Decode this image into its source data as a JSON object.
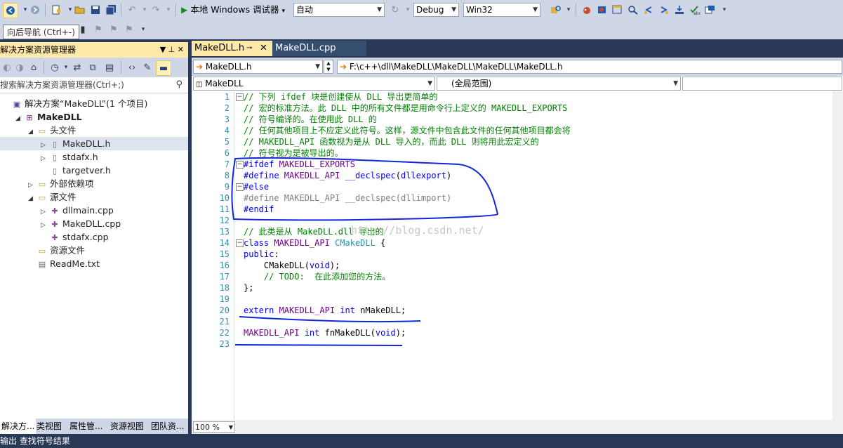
{
  "toolbar": {
    "start_label": "本地 Windows 调试器",
    "start_arrow": "▾",
    "auto_combo": "自动",
    "config_combo": "Debug",
    "platform_combo": "Win32"
  },
  "tooltip": "向后导航 (Ctrl+-)",
  "solution_explorer": {
    "title": "解决方案资源管理器",
    "title_pin": "▼ ⊥ ✕",
    "search_placeholder": "搜索解决方案资源管理器(Ctrl+;)",
    "tree": [
      {
        "label": "解决方案“MakeDLL”(1 个项目)",
        "icon": "solution-icon",
        "indent": 0,
        "tri": ""
      },
      {
        "label": "MakeDLL",
        "icon": "project-icon",
        "indent": 1,
        "tri": "◢",
        "bold": true
      },
      {
        "label": "头文件",
        "icon": "folder-icon",
        "indent": 2,
        "tri": "◢"
      },
      {
        "label": "MakeDLL.h",
        "icon": "header-file-icon",
        "indent": 3,
        "tri": "▷",
        "selected": true
      },
      {
        "label": "stdafx.h",
        "icon": "header-file-icon",
        "indent": 3,
        "tri": "▷"
      },
      {
        "label": "targetver.h",
        "icon": "header-file-icon",
        "indent": 3,
        "tri": ""
      },
      {
        "label": "外部依赖项",
        "icon": "folder-icon",
        "indent": 2,
        "tri": "▷"
      },
      {
        "label": "源文件",
        "icon": "folder-icon",
        "indent": 2,
        "tri": "◢"
      },
      {
        "label": "dllmain.cpp",
        "icon": "cpp-file-icon",
        "indent": 3,
        "tri": "▷"
      },
      {
        "label": "MakeDLL.cpp",
        "icon": "cpp-file-icon",
        "indent": 3,
        "tri": "▷"
      },
      {
        "label": "stdafx.cpp",
        "icon": "cpp-file-icon",
        "indent": 3,
        "tri": ""
      },
      {
        "label": "资源文件",
        "icon": "folder-icon",
        "indent": 2,
        "tri": ""
      },
      {
        "label": "ReadMe.txt",
        "icon": "text-file-icon",
        "indent": 2,
        "tri": ""
      }
    ],
    "bottom_tabs": [
      "解决方...",
      "类视图",
      "属性管...",
      "资源视图",
      "团队资..."
    ]
  },
  "status": "输出   查找符号结果",
  "editor": {
    "tabs": [
      {
        "label": "MakeDLL.h",
        "active": true
      },
      {
        "label": "MakeDLL.cpp",
        "active": false
      }
    ],
    "nav_file": "MakeDLL.h",
    "nav_path": "F:\\c++\\dll\\MakeDLL\\MakeDLL\\MakeDLL\\MakeDLL.h",
    "scope_project": "MakeDLL",
    "scope_global": "(全局范围)",
    "zoom": "100 %",
    "watermark": "http://blog.csdn.net/"
  },
  "code_lines": [
    [
      [
        "c-com",
        "// 下列 ifdef 块是创建使从 DLL 导出更简单的"
      ]
    ],
    [
      [
        "c-com",
        "// 宏的标准方法。此 DLL 中的所有文件都是用命令行上定义的 MAKEDLL_EXPORTS"
      ]
    ],
    [
      [
        "c-com",
        "// 符号编译的。在使用此 DLL 的"
      ]
    ],
    [
      [
        "c-com",
        "// 任何其他项目上不应定义此符号。这样，源文件中包含此文件的任何其他项目都会将"
      ]
    ],
    [
      [
        "c-com",
        "// MAKEDLL_API 函数视为是从 DLL 导入的，而此 DLL 则将用此宏定义的"
      ]
    ],
    [
      [
        "c-com",
        "// 符号视为是被导出的。"
      ]
    ],
    [
      [
        "c-pp",
        "#ifdef "
      ],
      [
        "c-mac",
        "MAKEDLL_EXPORTS"
      ]
    ],
    [
      [
        "c-pp",
        "#define "
      ],
      [
        "c-mac",
        "MAKEDLL_API "
      ],
      [
        "c-pp",
        "__declspec"
      ],
      [
        "",
        "("
      ],
      [
        "c-pp",
        "dllexport"
      ],
      [
        "",
        ")"
      ]
    ],
    [
      [
        "c-pp",
        "#else"
      ]
    ],
    [
      [
        "c-gray",
        "#define MAKEDLL_API __declspec(dllimport)"
      ]
    ],
    [
      [
        "c-pp",
        "#endif"
      ]
    ],
    [
      [
        "",
        ""
      ]
    ],
    [
      [
        "c-com",
        "// 此类是从 MakeDLL.dll 导出的"
      ]
    ],
    [
      [
        "c-kw",
        "class "
      ],
      [
        "c-mac",
        "MAKEDLL_API "
      ],
      [
        "c-type",
        "CMakeDLL"
      ],
      [
        "",
        " {"
      ]
    ],
    [
      [
        "c-kw",
        "public"
      ],
      [
        "",
        ":"
      ]
    ],
    [
      [
        "",
        "    CMakeDLL("
      ],
      [
        "c-kw",
        "void"
      ],
      [
        "",
        ");"
      ]
    ],
    [
      [
        "c-com",
        "    // TODO:  在此添加您的方法。"
      ]
    ],
    [
      [
        "",
        "};"
      ]
    ],
    [
      [
        "",
        ""
      ]
    ],
    [
      [
        "c-kw",
        "extern "
      ],
      [
        "c-mac",
        "MAKEDLL_API "
      ],
      [
        "c-kw",
        "int "
      ],
      [
        "",
        "nMakeDLL;"
      ]
    ],
    [
      [
        "",
        ""
      ]
    ],
    [
      [
        "c-mac",
        "MAKEDLL_API "
      ],
      [
        "c-kw",
        "int "
      ],
      [
        "",
        "fnMakeDLL("
      ],
      [
        "c-kw",
        "void"
      ],
      [
        "",
        ");"
      ]
    ],
    [
      [
        "",
        ""
      ]
    ]
  ],
  "line_numbers": [
    "1",
    "2",
    "3",
    "4",
    "5",
    "6",
    "7",
    "8",
    "9",
    "10",
    "11",
    "12",
    "13",
    "14",
    "15",
    "16",
    "17",
    "18",
    "19",
    "20",
    "21",
    "22",
    "23"
  ],
  "fold_rows": [
    0,
    6,
    8,
    13
  ],
  "fold_glyph": "−"
}
